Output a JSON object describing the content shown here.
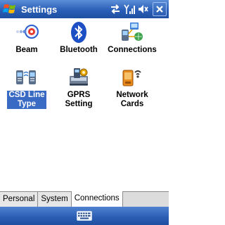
{
  "window": {
    "title": "Settings"
  },
  "icons": {
    "start": "windows-flag-icon",
    "sync": "sync-arrows-icon",
    "signal": "signal-strength-icon",
    "volume": "volume-icon",
    "close": "close-icon",
    "keyboard": "keyboard-icon"
  },
  "items": [
    {
      "label": "Beam",
      "icon": "beam-icon"
    },
    {
      "label": "Bluetooth",
      "icon": "bluetooth-icon"
    },
    {
      "label": "Connections",
      "icon": "connections-icon"
    },
    {
      "label": "CSD Line\nType",
      "icon": "csd-line-type-icon",
      "selected": true
    },
    {
      "label": "GPRS\nSetting",
      "icon": "gprs-setting-icon"
    },
    {
      "label": "Network\nCards",
      "icon": "network-cards-icon"
    }
  ],
  "tabs": [
    {
      "label": "Personal"
    },
    {
      "label": "System"
    },
    {
      "label": "Connections",
      "active": true
    }
  ],
  "colors": {
    "title_bar": "#2a5fb8",
    "selection": "#3a6bc4"
  }
}
